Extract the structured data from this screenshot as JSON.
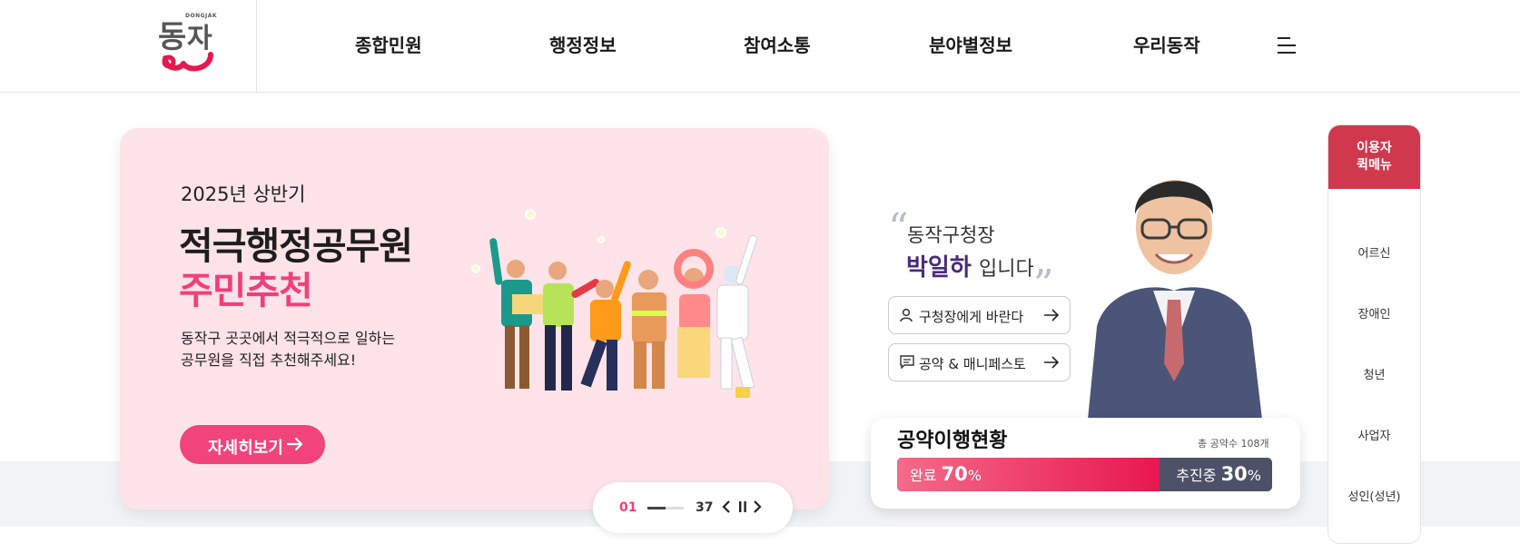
{
  "header": {
    "logo_small": "DONGJAK",
    "logo_text": "동작",
    "nav": [
      "종합민원",
      "행정정보",
      "참여소통",
      "분야별정보",
      "우리동작"
    ]
  },
  "promo": {
    "year": "2025년 상반기",
    "title_line1": "적극행정공무원",
    "title_line2": "주민추천",
    "desc_line1": "동작구 곳곳에서 적극적으로 일하는",
    "desc_line2": "공무원을 직접 추천해주세요!",
    "button_label": "자세히보기"
  },
  "slider": {
    "current": "01",
    "total": "37",
    "progress": 0.03
  },
  "mayor": {
    "line1": "동작구청장",
    "name": "박일하",
    "suffix": "입니다",
    "buttons": [
      "구청장에게 바란다",
      "공약 & 매니페스토"
    ]
  },
  "pledge": {
    "title": "공약이행현황",
    "total": "총 공약수 108개",
    "done_label": "완료",
    "done_value": "70",
    "progress_label": "추진중",
    "progress_value": "30",
    "unit": "%",
    "done_fraction": 0.7
  },
  "quick_menu": {
    "title_line1": "이용자",
    "title_line2": "퀵메뉴",
    "items": [
      "어르신",
      "장애인",
      "청년",
      "사업자",
      "성인(성년)"
    ]
  },
  "colors": {
    "brand_pink": "#f0407a",
    "brand_red": "#d0384e",
    "promo_bg": "#fee3e8",
    "navy": "#4c5168"
  }
}
